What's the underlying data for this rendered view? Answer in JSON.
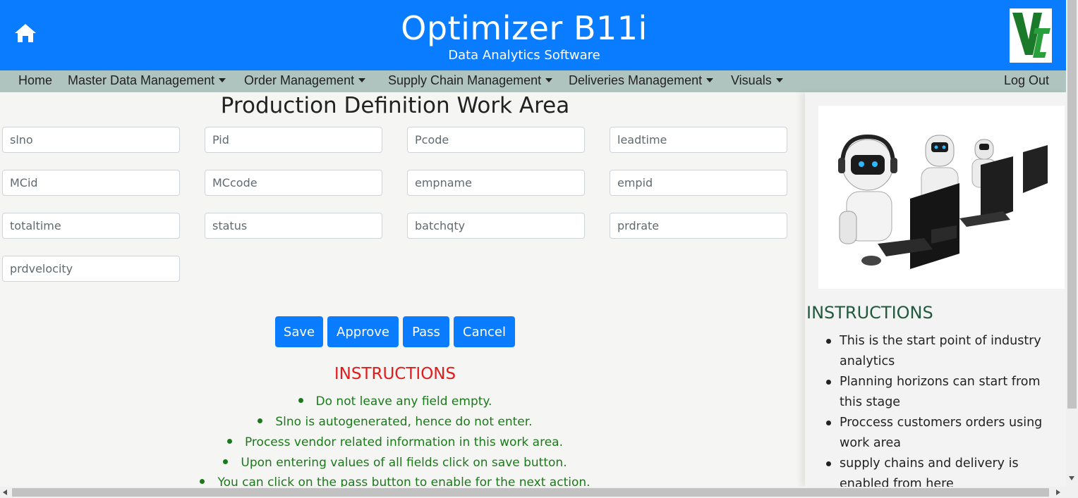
{
  "header": {
    "title": "Optimizer B11i",
    "subtitle": "Data Analytics Software",
    "home_icon": "home-icon",
    "logo_icon": "vt-logo",
    "background_color": "#0a7cff"
  },
  "nav": {
    "items": [
      {
        "label": "Home",
        "dropdown": false
      },
      {
        "label": "Master Data Management",
        "dropdown": true
      },
      {
        "label": "Order Management",
        "dropdown": true
      },
      {
        "label": "Supply Chain Management",
        "dropdown": true
      },
      {
        "label": "Deliveries Management",
        "dropdown": true
      },
      {
        "label": "Visuals",
        "dropdown": true
      }
    ],
    "logout": "Log Out",
    "background_color": "#b0c4bf"
  },
  "main": {
    "title": "Production Definition Work Area",
    "fields": [
      {
        "placeholder": "slno",
        "value": ""
      },
      {
        "placeholder": "Pid",
        "value": ""
      },
      {
        "placeholder": "Pcode",
        "value": ""
      },
      {
        "placeholder": "leadtime",
        "value": ""
      },
      {
        "placeholder": "MCid",
        "value": ""
      },
      {
        "placeholder": "MCcode",
        "value": ""
      },
      {
        "placeholder": "empname",
        "value": ""
      },
      {
        "placeholder": "empid",
        "value": ""
      },
      {
        "placeholder": "totaltime",
        "value": ""
      },
      {
        "placeholder": "status",
        "value": ""
      },
      {
        "placeholder": "batchqty",
        "value": ""
      },
      {
        "placeholder": "prdrate",
        "value": ""
      },
      {
        "placeholder": "prdvelocity",
        "value": ""
      }
    ],
    "buttons": {
      "save": "Save",
      "approve": "Approve",
      "pass": "Pass",
      "cancel": "Cancel"
    },
    "instructions_title": "INSTRUCTIONS",
    "instructions": [
      "Do not leave any field empty.",
      "Slno is autogenerated, hence do not enter.",
      "Process vendor related information in this work area.",
      "Upon entering values of all fields click on save button.",
      "You can click on the pass button to enable for the next action."
    ],
    "instructions_title_color": "#e51b1b",
    "instructions_color": "#1a7a1a"
  },
  "side": {
    "image_icon": "robots-at-computers-illustration",
    "title": "INSTRUCTIONS",
    "items": [
      "This is the start point of industry analytics",
      "Planning horizons can start from this stage",
      "Proccess customers orders using work area",
      "supply chains and delivery is enabled from here"
    ],
    "title_color": "#1f5a3e"
  }
}
